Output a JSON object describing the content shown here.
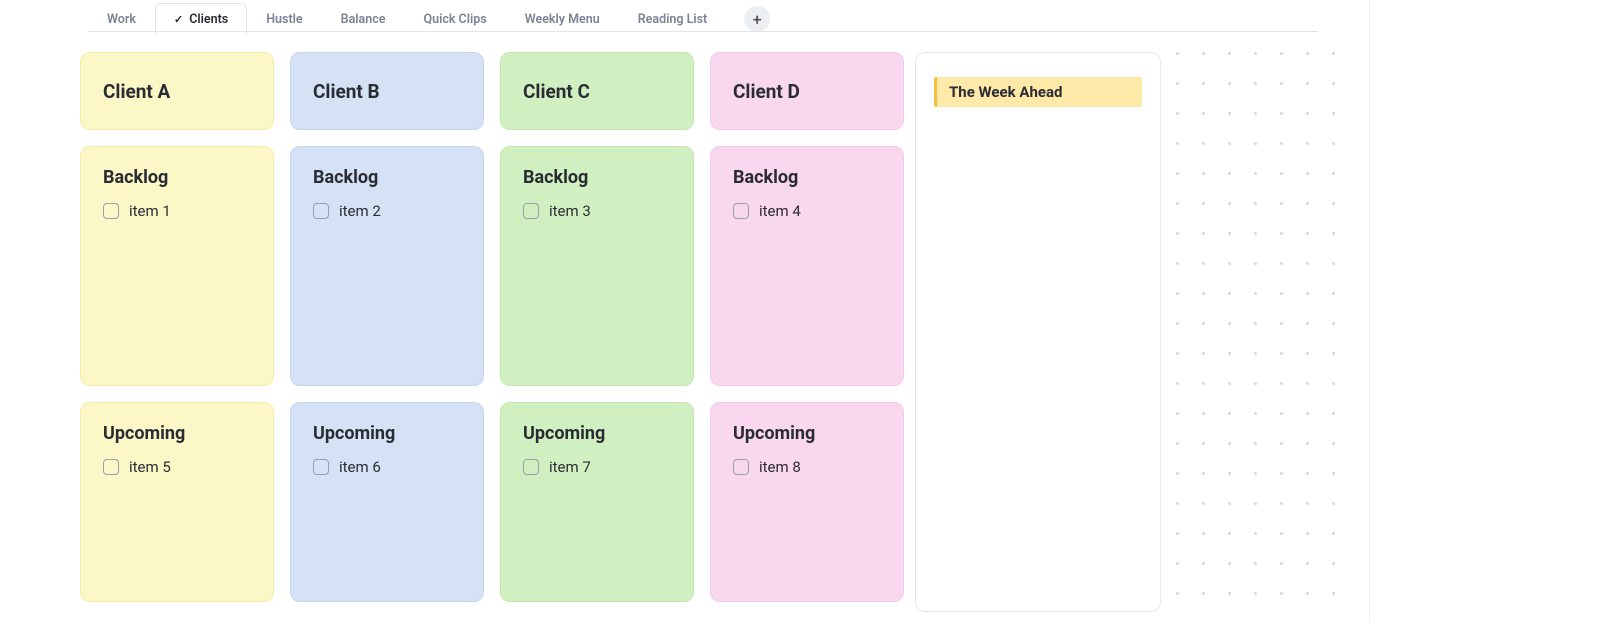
{
  "tabs": [
    {
      "label": "Work",
      "active": false
    },
    {
      "label": "Clients",
      "active": true
    },
    {
      "label": "Hustle",
      "active": false
    },
    {
      "label": "Balance",
      "active": false
    },
    {
      "label": "Quick Clips",
      "active": false
    },
    {
      "label": "Weekly Menu",
      "active": false
    },
    {
      "label": "Reading List",
      "active": false
    }
  ],
  "columns": [
    {
      "theme": "yellow",
      "header": "Client A",
      "backlog_title": "Backlog",
      "backlog_item": "item 1",
      "upcoming_title": "Upcoming",
      "upcoming_item": "item 5"
    },
    {
      "theme": "blue",
      "header": "Client B",
      "backlog_title": "Backlog",
      "backlog_item": "item 2",
      "upcoming_title": "Upcoming",
      "upcoming_item": "item 6"
    },
    {
      "theme": "green",
      "header": "Client C",
      "backlog_title": "Backlog",
      "backlog_item": "item 3",
      "upcoming_title": "Upcoming",
      "upcoming_item": "item 7"
    },
    {
      "theme": "pink",
      "header": "Client D",
      "backlog_title": "Backlog",
      "backlog_item": "item 4",
      "upcoming_title": "Upcoming",
      "upcoming_item": "item 8"
    }
  ],
  "side_panel": {
    "heading": "The Week Ahead"
  },
  "icons": {
    "plus": "+",
    "check": "✓"
  }
}
